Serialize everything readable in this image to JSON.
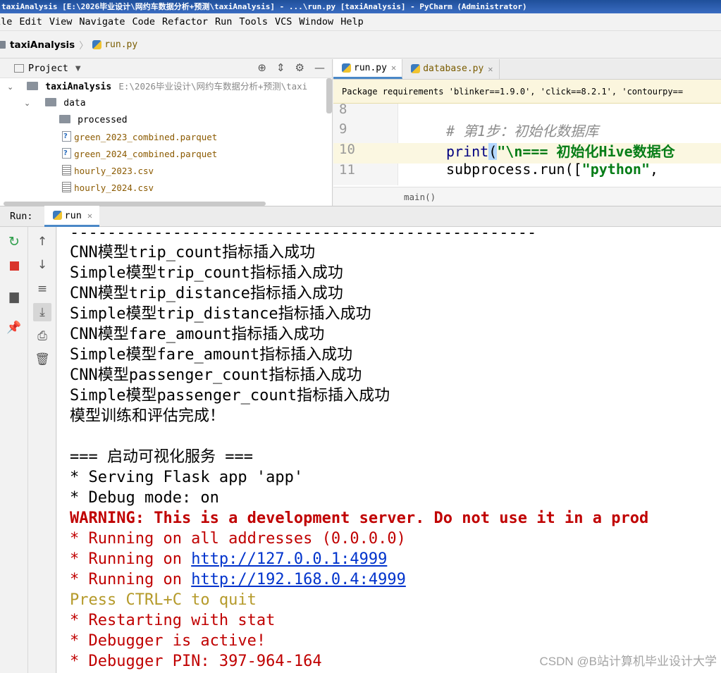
{
  "window": {
    "title": "taxiAnalysis [E:\\2026毕业设计\\网约车数据分析+预测\\taxiAnalysis] - ...\\run.py [taxiAnalysis] - PyCharm (Administrator)"
  },
  "menu": [
    "ile",
    "Edit",
    "View",
    "Navigate",
    "Code",
    "Refactor",
    "Run",
    "Tools",
    "VCS",
    "Window",
    "Help"
  ],
  "navbar": {
    "project": "taxiAnalysis",
    "file": "run.py"
  },
  "project_panel": {
    "title": "Project",
    "tree": [
      {
        "label": "taxiAnalysis",
        "path": "E:\\2026毕业设计\\网约车数据分析+预测\\taxi"
      },
      {
        "label": "data"
      },
      {
        "label": "processed"
      },
      {
        "label": "green_2023_combined.parquet"
      },
      {
        "label": "green_2024_combined.parquet"
      },
      {
        "label": "hourly_2023.csv"
      },
      {
        "label": "hourly_2024.csv"
      }
    ]
  },
  "editor": {
    "tabs": [
      {
        "label": "run.py",
        "active": true
      },
      {
        "label": "database.py",
        "active": false
      }
    ],
    "package_banner": "Package requirements 'blinker==1.9.0', 'click==8.2.1', 'contourpy==",
    "lines": [
      {
        "num": "8",
        "code": ""
      },
      {
        "num": "9",
        "code": "# 第1步：初始化数据库"
      },
      {
        "num": "10",
        "code_kw": "print",
        "code_paren": "(",
        "code_str": "\"\\n=== 初始化Hive数据仓"
      },
      {
        "num": "11",
        "code": "subprocess.run([",
        "code_str": "\"python\"",
        "code_tail": ","
      }
    ],
    "breadcrumb": "main()"
  },
  "run_panel": {
    "label": "Run:",
    "tab": "run",
    "console": [
      {
        "text": "--------------------------------------------------",
        "style": "normal"
      },
      {
        "text": "CNN模型trip_count指标插入成功",
        "style": "normal"
      },
      {
        "text": "Simple模型trip_count指标插入成功",
        "style": "normal"
      },
      {
        "text": "CNN模型trip_distance指标插入成功",
        "style": "normal"
      },
      {
        "text": "Simple模型trip_distance指标插入成功",
        "style": "normal"
      },
      {
        "text": "CNN模型fare_amount指标插入成功",
        "style": "normal"
      },
      {
        "text": "Simple模型fare_amount指标插入成功",
        "style": "normal"
      },
      {
        "text": "CNN模型passenger_count指标插入成功",
        "style": "normal"
      },
      {
        "text": "Simple模型passenger_count指标插入成功",
        "style": "normal"
      },
      {
        "text": "模型训练和评估完成！",
        "style": "normal"
      },
      {
        "text": "",
        "style": "normal"
      },
      {
        "text": "=== 启动可视化服务 ===",
        "style": "normal"
      },
      {
        "text": " * Serving Flask app 'app'",
        "style": "normal"
      },
      {
        "text": " * Debug mode: on",
        "style": "normal"
      },
      {
        "text": "WARNING: This is a development server. Do not use it in a prod",
        "style": "err"
      },
      {
        "text": " * Running on all addresses (0.0.0.0)",
        "style": "red"
      },
      {
        "prefix": " * Running on ",
        "link": "http://127.0.0.1:4999",
        "style": "red-link"
      },
      {
        "prefix": " * Running on ",
        "link": "http://192.168.0.4:4999",
        "style": "red-link"
      },
      {
        "text": "Press CTRL+C to quit",
        "style": "yel"
      },
      {
        "text": " * Restarting with stat",
        "style": "red"
      },
      {
        "text": " * Debugger is active!",
        "style": "red"
      },
      {
        "text": " * Debugger PIN: 397-964-164",
        "style": "red"
      }
    ]
  },
  "watermark": "CSDN @B站计算机毕业设计大学",
  "colors": {
    "error": "#c00000",
    "link": "#0033cc",
    "press": "#b59a2a",
    "accent": "#4a88c7"
  }
}
